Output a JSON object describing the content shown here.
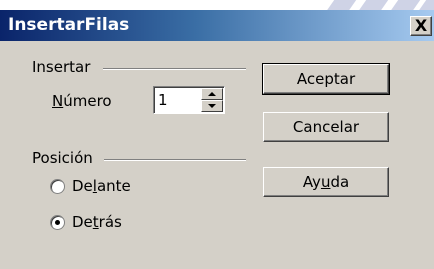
{
  "dialog": {
    "title": "InsertarFilas",
    "close_label": "X"
  },
  "insert_group": {
    "label": "Insertar",
    "number_label_mnemonic": "N",
    "number_label_rest": "úmero",
    "number_value": "1"
  },
  "position_group": {
    "label": "Posición",
    "before_pre": "De",
    "before_mnemonic": "l",
    "before_post": "ante",
    "after_pre": "De",
    "after_mnemonic": "t",
    "after_post": "rás",
    "selected": "after"
  },
  "buttons": {
    "accept": "Aceptar",
    "cancel": "Cancelar",
    "help_pre": "Ay",
    "help_mnemonic": "u",
    "help_post": "da"
  }
}
